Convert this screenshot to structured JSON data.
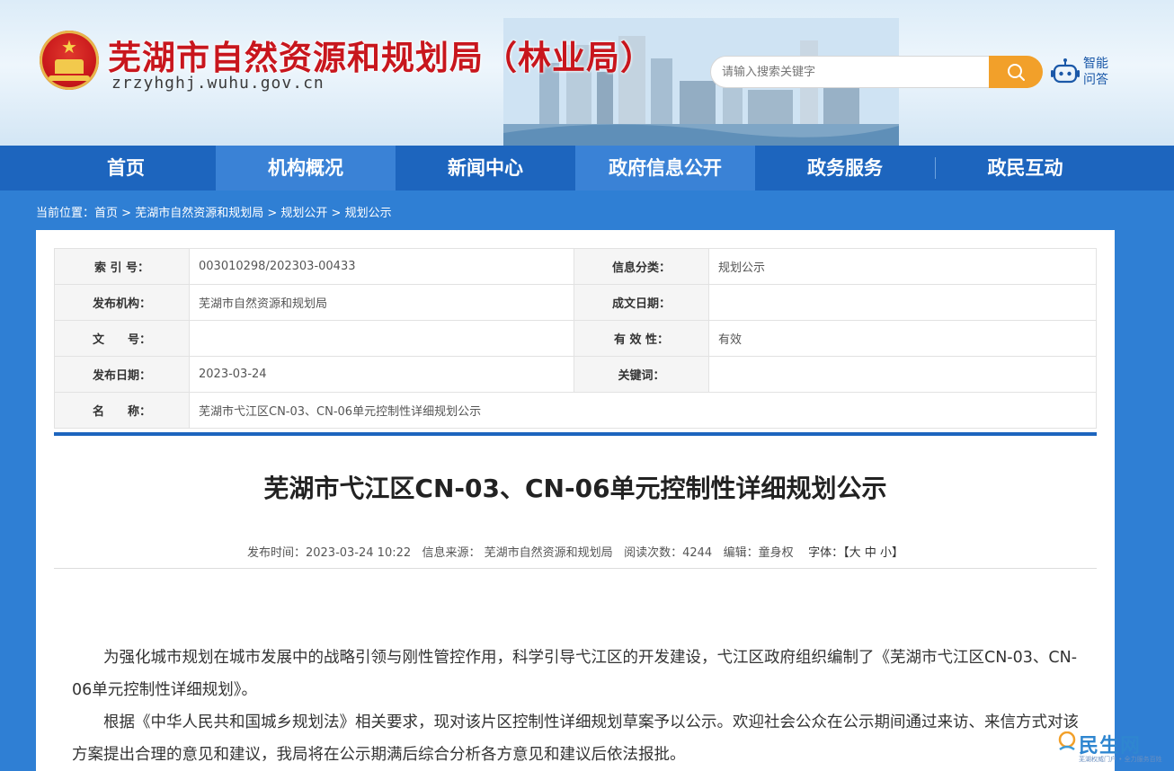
{
  "header": {
    "site_title": "芜湖市自然资源和规划局（林业局）",
    "domain": "zrzyhghj.wuhu.gov.cn",
    "search_placeholder": "请输入搜索关键字",
    "assistant_label": "智能问答"
  },
  "nav": {
    "items": [
      {
        "label": "首页"
      },
      {
        "label": "机构概况"
      },
      {
        "label": "新闻中心"
      },
      {
        "label": "政府信息公开"
      },
      {
        "label": "政务服务"
      },
      {
        "label": "政民互动"
      }
    ]
  },
  "breadcrumb": {
    "prefix": "当前位置：",
    "items": [
      "首页",
      "芜湖市自然资源和规划局",
      "规划公开",
      "规划公示"
    ],
    "separator": " > "
  },
  "meta": {
    "index_label": "索 引 号：",
    "index_value": "003010298/202303-00433",
    "category_label": "信息分类：",
    "category_value": "规划公示",
    "org_label": "发布机构：",
    "org_value": "芜湖市自然资源和规划局",
    "written_label": "成文日期：",
    "written_value": "",
    "doc_label": "文　　号：",
    "doc_value": "",
    "validity_label": "有 效 性：",
    "validity_value": "有效",
    "pubdate_label": "发布日期：",
    "pubdate_value": "2023-03-24",
    "keyword_label": "关键词：",
    "keyword_value": "",
    "name_label": "名　　称：",
    "name_value": "芜湖市弋江区CN-03、CN-06单元控制性详细规划公示"
  },
  "article": {
    "title": "芜湖市弋江区CN-03、CN-06单元控制性详细规划公示",
    "publish_time": "发布时间：2023-03-24 10:22",
    "source": "信息来源：  芜湖市自然资源和规划局",
    "views": "阅读次数：4244",
    "editor": "编辑：童身权",
    "font_label": "字体：",
    "font_open": "【",
    "font_large": "大",
    "font_medium": "中",
    "font_small": "小",
    "font_close": "】",
    "paragraphs": [
      "为强化城市规划在城市发展中的战略引领与刚性管控作用，科学引导弋江区的开发建设，弋江区政府组织编制了《芜湖市弋江区CN-03、CN-06单元控制性详细规划》。",
      "根据《中华人民共和国城乡规划法》相关要求，现对该片区控制性详细规划草案予以公示。欢迎社会公众在公示期间通过来访、来信方式对该方案提出合理的意见和建议，我局将在公示期满后综合分析各方意见和建议后依法报批。"
    ]
  },
  "watermark": {
    "text": "民生网",
    "sub": "芜湖权威门户 • 全力服务百姓"
  },
  "colors": {
    "nav_bg": "#1d65be",
    "nav_active": "#3a82d6",
    "title_red": "#c8161d",
    "search_btn": "#f2a02a"
  }
}
